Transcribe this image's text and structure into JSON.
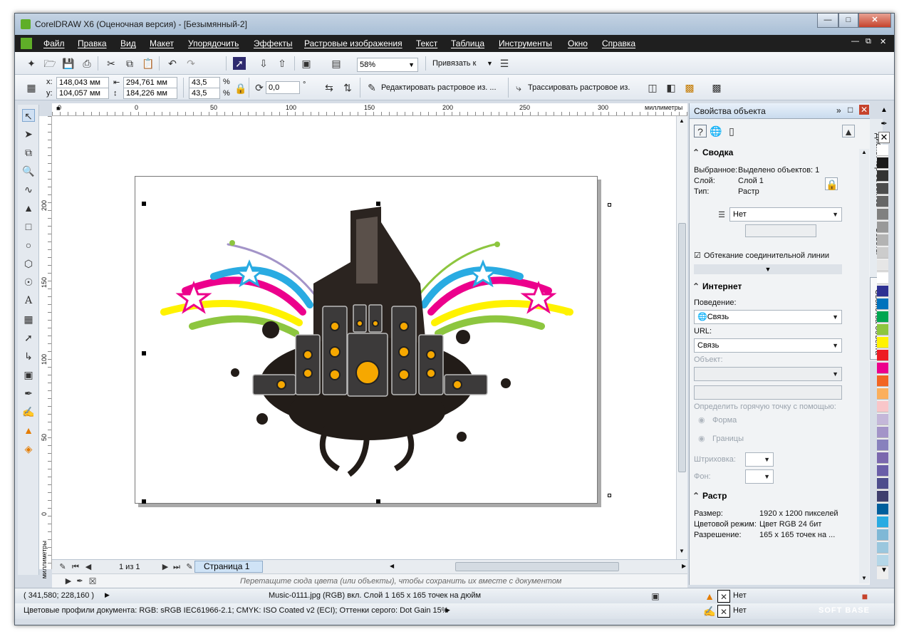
{
  "window": {
    "title": "CorelDRAW X6 (Оценочная версия) - [Безымянный-2]"
  },
  "menu": [
    "Файл",
    "Правка",
    "Вид",
    "Макет",
    "Упорядочить",
    "Эффекты",
    "Растровые изображения",
    "Текст",
    "Таблица",
    "Инструменты",
    "Окно",
    "Справка"
  ],
  "toolbar1": {
    "zoom": "58%",
    "snap_label": "Привязать к"
  },
  "toolbar2": {
    "x_label": "x:",
    "y_label": "y:",
    "x": "148,043 мм",
    "y": "104,057 мм",
    "width": "294,761 мм",
    "height": "184,226 мм",
    "scale_x": "43,5",
    "scale_y": "43,5",
    "pct": "%",
    "rotation": "0,0",
    "degree": "°",
    "edit_bitmap": "Редактировать растровое из. ...",
    "trace_bitmap": "Трассировать растровое из."
  },
  "ruler": {
    "top_ticks": [
      "0",
      "0",
      "50",
      "100",
      "150",
      "200",
      "250",
      "300"
    ],
    "units": "миллиметры",
    "left_ticks": [
      "200",
      "150",
      "100",
      "50",
      "0"
    ]
  },
  "pagebar": {
    "page_count": "1 из 1",
    "tab": "Страница 1"
  },
  "hint": "Перетащите сюда цвета (или объекты), чтобы сохранить их вместе с документом",
  "status": {
    "coords": "( 341,580; 228,160 )",
    "object_info": "Music-0111.jpg (RGB) вкл. Слой 1 165 x 165 точек на дюйм",
    "fill_none": "Нет",
    "outline_none": "Нет",
    "profiles": "Цветовые профили документа: RGB: sRGB IEC61966-2.1; CMYK: ISO Coated v2 (ECI); Оттенки серого: Dot Gain 15%"
  },
  "docker": {
    "title": "Свойства объекта",
    "summary": {
      "heading": "Сводка",
      "selected_label": "Выбранное:",
      "selected_value": "Выделено объектов: 1",
      "layer_label": "Слой:",
      "layer_value": "Слой 1",
      "type_label": "Тип:",
      "type_value": "Растр",
      "wrap_value": "Нет",
      "connector_wrap": "Обтекание соединительной линии"
    },
    "internet": {
      "heading": "Интернет",
      "behavior_label": "Поведение:",
      "behavior_value": "Связь",
      "url_label": "URL:",
      "url_value": "Связь",
      "object_label": "Объект:",
      "hotspot_label": "Определить горячую точку с помощью:",
      "shape_option": "Форма",
      "bounds_option": "Границы",
      "hatch_label": "Штриховка:",
      "bg_label": "Фон:"
    },
    "raster": {
      "heading": "Растр",
      "size_label": "Размер:",
      "size_value": "1920 x 1200 пикселей",
      "mode_label": "Цветовой режим:",
      "mode_value": "Цвет RGB 24 бит",
      "res_label": "Разрешение:",
      "res_value": "165 x 165 точек на ..."
    }
  },
  "side_tabs": [
    "Диспетчер объектов",
    "Советы",
    "Свойства объекта"
  ],
  "palette": [
    "#ffffff",
    "#1a1a1a",
    "#333333",
    "#4d4d4d",
    "#666666",
    "#808080",
    "#999999",
    "#b3b3b3",
    "#cccccc",
    "#e6e6e6",
    "#ffffff",
    "#2e3192",
    "#0072bc",
    "#00a651",
    "#8dc63f",
    "#fff200",
    "#ed1c24",
    "#ec008c",
    "#f26522",
    "#fbaf5d",
    "#f9c6c9",
    "#c4b7d9",
    "#a394c8",
    "#8781bd",
    "#7b68ae",
    "#6a5ea8",
    "#4d4d8c",
    "#3f3f6e",
    "#005e9c",
    "#29abe2",
    "#7fb8d6",
    "#9ac7de",
    "#b5d7e8"
  ],
  "watermark": "SOFT BASE"
}
